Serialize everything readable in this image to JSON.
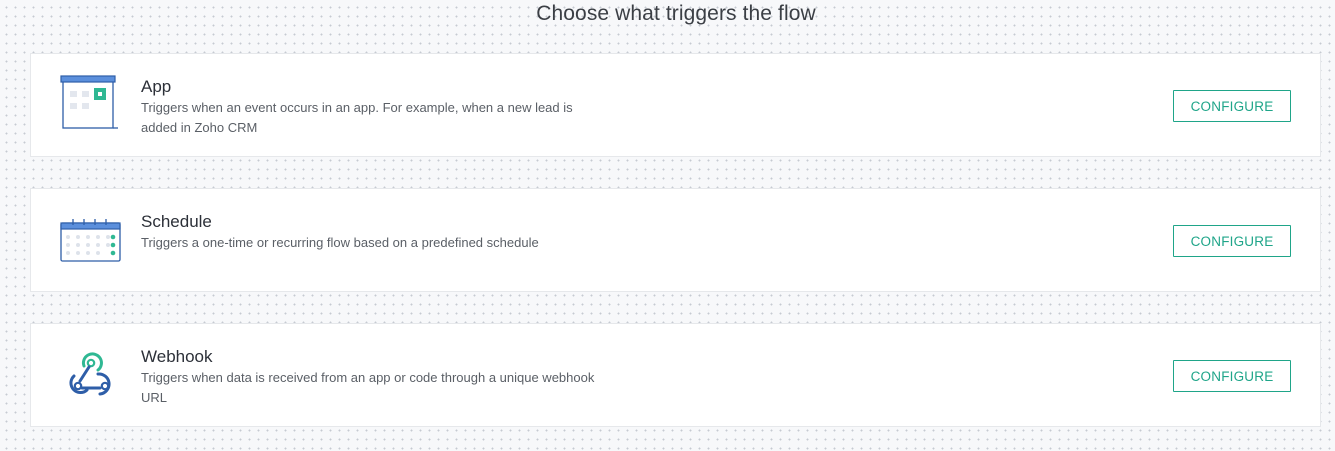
{
  "page": {
    "title": "Choose what triggers the flow"
  },
  "colors": {
    "accent": "#1fa589",
    "icon_blue": "#2e5ea8",
    "icon_light_blue": "#5b8fdc"
  },
  "triggers": [
    {
      "icon": "app-window-icon",
      "title": "App",
      "description": "Triggers when an event occurs in an app. For example, when a new lead is added in Zoho CRM",
      "button_label": "CONFIGURE"
    },
    {
      "icon": "calendar-schedule-icon",
      "title": "Schedule",
      "description": "Triggers a one-time or recurring flow based on a predefined schedule",
      "button_label": "CONFIGURE"
    },
    {
      "icon": "webhook-icon",
      "title": "Webhook",
      "description": "Triggers when data is received from an app or code through a unique webhook URL",
      "button_label": "CONFIGURE"
    }
  ]
}
